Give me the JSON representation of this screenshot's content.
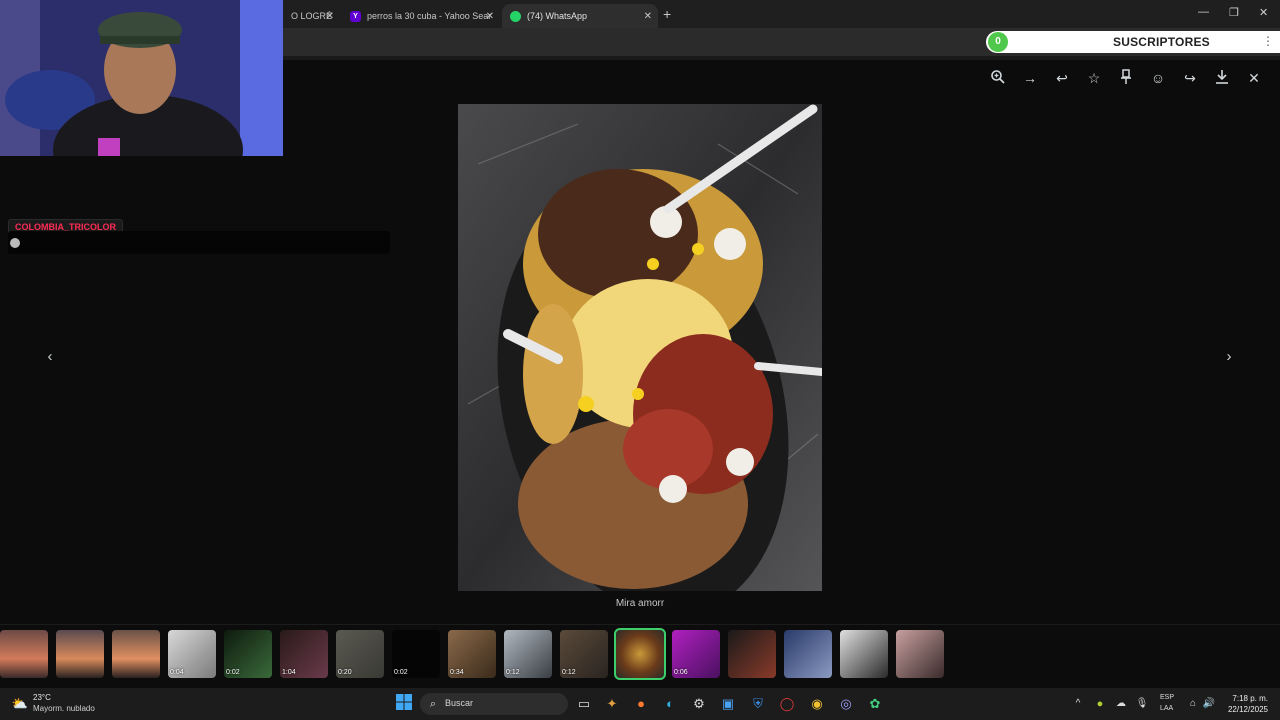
{
  "browser": {
    "tabs": [
      {
        "title": "O LOGRÉ",
        "icon": "generic-tab-icon",
        "active": false
      },
      {
        "title": "perros la 30 cuba - Yahoo Sear",
        "icon": "yahoo-icon",
        "active": false
      },
      {
        "title": "(74) WhatsApp",
        "icon": "whatsapp-icon",
        "active": true
      }
    ],
    "new_tab": "+",
    "window_controls": {
      "minimize": "—",
      "maximize": "❐",
      "close": "✕"
    }
  },
  "overlay": {
    "subscribers_count": "0",
    "subscribers_label": "SUSCRIPTORES",
    "chat_username": "COLOMBIA_TRICOLOR"
  },
  "viewer": {
    "toolbar_icons": [
      "zoom-in-icon",
      "forward-icon",
      "reply-icon",
      "star-icon",
      "pin-icon",
      "react-icon",
      "share-icon",
      "download-icon",
      "close-icon"
    ],
    "caption": "Mira amorr",
    "prev": "‹",
    "next": "›"
  },
  "thumbnails": [
    {
      "duration": ""
    },
    {
      "duration": ""
    },
    {
      "duration": ""
    },
    {
      "duration": "0:04"
    },
    {
      "duration": "0:02"
    },
    {
      "duration": "1:04"
    },
    {
      "duration": "0:20"
    },
    {
      "duration": "0:02"
    },
    {
      "duration": "0:34"
    },
    {
      "duration": "0:12"
    },
    {
      "duration": "0:12"
    },
    {
      "duration": ""
    },
    {
      "duration": "0:06"
    },
    {
      "duration": ""
    },
    {
      "duration": ""
    },
    {
      "duration": ""
    },
    {
      "duration": ""
    }
  ],
  "taskbar": {
    "temperature": "23°C",
    "weather": "Mayorm. nublado",
    "search_placeholder": "Buscar",
    "lang_top": "ESP",
    "lang_bottom": "LAA",
    "time": "7:18 p. m.",
    "date": "22/12/2025"
  },
  "colors": {
    "accent_green": "#3ccf6a",
    "chat_red": "#ff2b55"
  }
}
